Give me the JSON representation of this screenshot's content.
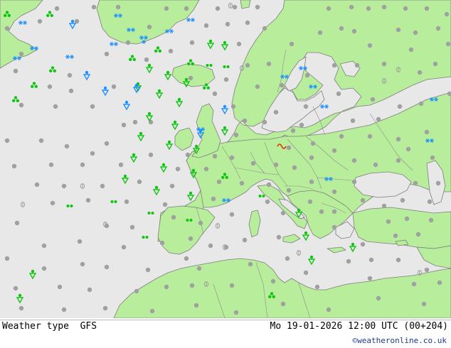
{
  "header": {
    "left_label": "Weather type  GFS",
    "right_label": "Mo 19-01-2026 12:00 UTC (00+204)"
  },
  "credit": "©weatheronline.co.uk",
  "colors": {
    "sea": "#e8e8e8",
    "land": "#b8ee9b",
    "border": "#808080",
    "rain": "#11c411",
    "snow": "#1e90ff",
    "cloud": "#a0a0a0",
    "thunder": "#dd3300"
  },
  "legend_symbols": [
    "cloud-dot",
    "rain-drizzle-symbol",
    "rain-shower-symbol",
    "snow-symbol",
    "mist-symbol"
  ]
}
